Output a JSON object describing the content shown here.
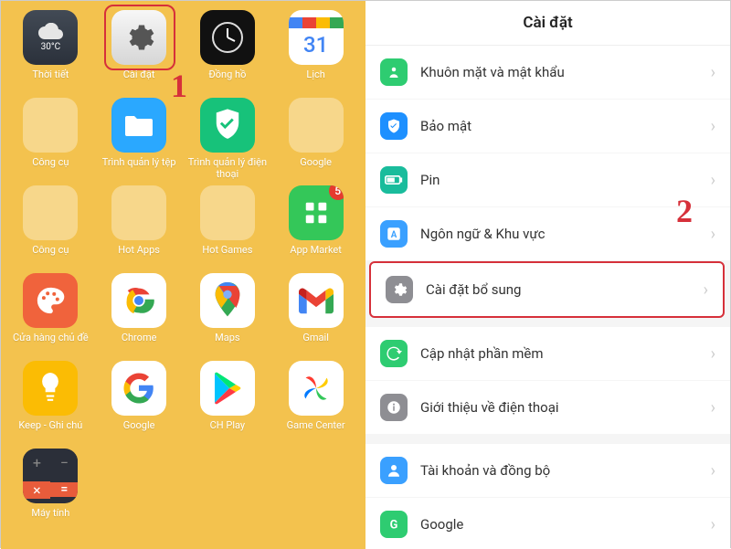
{
  "step1": "1",
  "step2": "2",
  "left": {
    "apps": [
      {
        "label": "Thời tiết",
        "temp": "30°C"
      },
      {
        "label": "Cài đặt"
      },
      {
        "label": "Đồng hồ"
      },
      {
        "label": "Lịch",
        "cal": "31"
      },
      {
        "label": "Công cụ"
      },
      {
        "label": "Trình quản lý tệp"
      },
      {
        "label": "Trình quản lý điện thoại"
      },
      {
        "label": "Google"
      },
      {
        "label": "Công cụ"
      },
      {
        "label": "Hot Apps"
      },
      {
        "label": "Hot Games"
      },
      {
        "label": "App Market",
        "badge": "5"
      },
      {
        "label": "Cửa hàng chủ đề"
      },
      {
        "label": "Chrome"
      },
      {
        "label": "Maps"
      },
      {
        "label": "Gmail"
      },
      {
        "label": "Keep - Ghi chú"
      },
      {
        "label": "Google"
      },
      {
        "label": "CH Play"
      },
      {
        "label": "Game Center"
      },
      {
        "label": "Máy tính"
      }
    ]
  },
  "right": {
    "title": "Cài đặt",
    "items": [
      {
        "label": "Khuôn mặt và mật khẩu",
        "color": "#2ecc71",
        "icon": "face"
      },
      {
        "label": "Bảo mật",
        "color": "#1e90ff",
        "icon": "shield"
      },
      {
        "label": "Pin",
        "color": "#1abc9c",
        "icon": "battery"
      },
      {
        "label": "Ngôn ngữ & Khu vực",
        "color": "#3aa0ff",
        "icon": "lang"
      },
      {
        "label": "Cài đặt bổ sung",
        "color": "#8e8e93",
        "icon": "gear",
        "highlight": true
      },
      {
        "gap": true
      },
      {
        "label": "Cập nhật phần mềm",
        "color": "#2ecc71",
        "icon": "update"
      },
      {
        "label": "Giới thiệu về điện thoại",
        "color": "#8e8e93",
        "icon": "info"
      },
      {
        "gap": true
      },
      {
        "label": "Tài khoản và đồng bộ",
        "color": "#3aa0ff",
        "icon": "user"
      },
      {
        "label": "Google",
        "color": "#2ecc71",
        "icon": "g"
      }
    ]
  }
}
